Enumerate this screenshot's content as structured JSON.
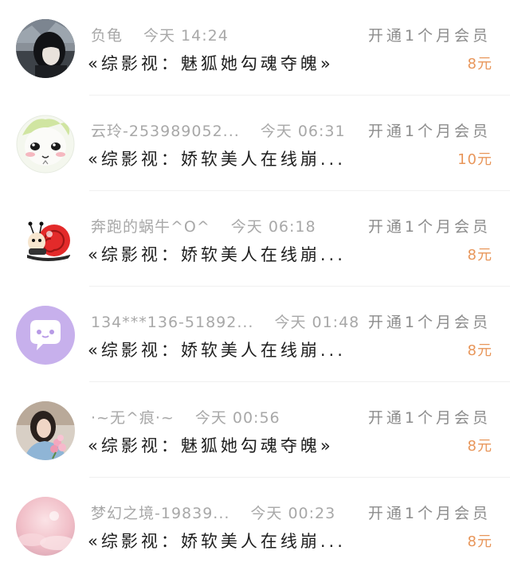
{
  "colors": {
    "price": "#e8965a",
    "meta": "#a8a8a8",
    "title": "#1e1e1e"
  },
  "items": [
    {
      "name": "负龟",
      "time": "今天 14:24",
      "plan": "开通1个月会员",
      "title": "«综影视：魅狐她勾魂夺魄»",
      "price": "8元",
      "avatar": "dark-hair-girl-avatar"
    },
    {
      "name": "云玲-253989052...",
      "time": "今天 06:31",
      "plan": "开通1个月会员",
      "title": "«综影视：娇软美人在线崩...",
      "price": "10元",
      "avatar": "cartoon-face-avatar"
    },
    {
      "name": "奔跑的蜗牛^O^",
      "time": "今天 06:18",
      "plan": "开通1个月会员",
      "title": "«综影视：娇软美人在线崩...",
      "price": "8元",
      "avatar": "snail-avatar"
    },
    {
      "name": "134***136-51892...",
      "time": "今天 01:48",
      "plan": "开通1个月会员",
      "title": "«综影视：娇软美人在线崩...",
      "price": "8元",
      "avatar": "chat-bubble-avatar"
    },
    {
      "name": "·~无^痕·~",
      "time": "今天 00:56",
      "plan": "开通1个月会员",
      "title": "«综影视：魅狐她勾魂夺魄»",
      "price": "8元",
      "avatar": "girl-flowers-avatar"
    },
    {
      "name": "梦幻之境-19839...",
      "time": "今天 00:23",
      "plan": "开通1个月会员",
      "title": "«综影视：娇软美人在线崩...",
      "price": "8元",
      "avatar": "pink-sky-avatar"
    }
  ]
}
